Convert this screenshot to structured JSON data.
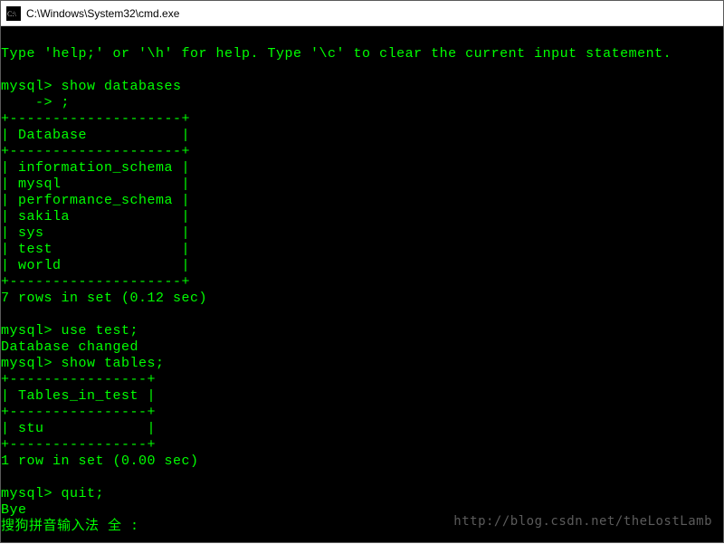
{
  "titlebar": {
    "icon_name": "cmd-icon",
    "path": "C:\\Windows\\System32\\cmd.exe"
  },
  "terminal": {
    "help_line": "Type 'help;' or '\\h' for help. Type '\\c' to clear the current input statement.",
    "prompt": "mysql>",
    "cont_prompt": "    ->",
    "cmd_show_databases": "show databases",
    "semicolon": ";",
    "db_table": {
      "border_top": "+--------------------+",
      "header_row": "| Database           |",
      "border_mid": "+--------------------+",
      "rows": [
        "| information_schema |",
        "| mysql              |",
        "| performance_schema |",
        "| sakila             |",
        "| sys                |",
        "| test               |",
        "| world              |",
        "+--------------------+"
      ]
    },
    "db_result": "7 rows in set (0.12 sec)",
    "cmd_use_test": "use test;",
    "db_changed": "Database changed",
    "cmd_show_tables": "show tables;",
    "tbl_table": {
      "border_top": "+----------------+",
      "header_row": "| Tables_in_test |",
      "border_mid": "+----------------+",
      "rows": [
        "| stu            |",
        "+----------------+"
      ]
    },
    "tbl_result": "1 row in set (0.00 sec)",
    "cmd_quit": "quit;",
    "bye": "Bye",
    "ime_status": "搜狗拼音输入法 全 :"
  },
  "watermark": "http://blog.csdn.net/theLostLamb"
}
